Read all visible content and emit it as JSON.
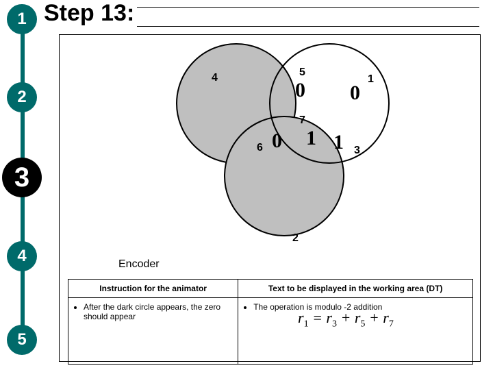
{
  "title": "Step 13:",
  "stepper": {
    "steps": [
      "1",
      "2",
      "3",
      "4",
      "5"
    ],
    "current_index": 2
  },
  "venn": {
    "regions": {
      "r1_label": "1",
      "r2_label": "2",
      "r3_label": "3",
      "r4_label": "4",
      "r5_label": "5",
      "r6_label": "6",
      "r7_label": "7"
    },
    "bits": {
      "r5": "0",
      "r1": "0",
      "r6": "0",
      "r7": "1",
      "r3": "1"
    }
  },
  "encoder_label": "Encoder",
  "table": {
    "header_left": "Instruction for the animator",
    "header_right": "Text to be displayed in the working area (DT)",
    "left_bullet": "After the dark circle appears, the zero should appear",
    "right_bullet": "The operation is modulo -2 addition"
  },
  "formula": {
    "lhs_var": "r",
    "lhs_sub": "1",
    "eq": " = ",
    "t1_var": "r",
    "t1_sub": "3",
    "plus1": " + ",
    "t2_var": "r",
    "t2_sub": "5",
    "plus2": " + ",
    "t3_var": "r",
    "t3_sub": "7"
  }
}
